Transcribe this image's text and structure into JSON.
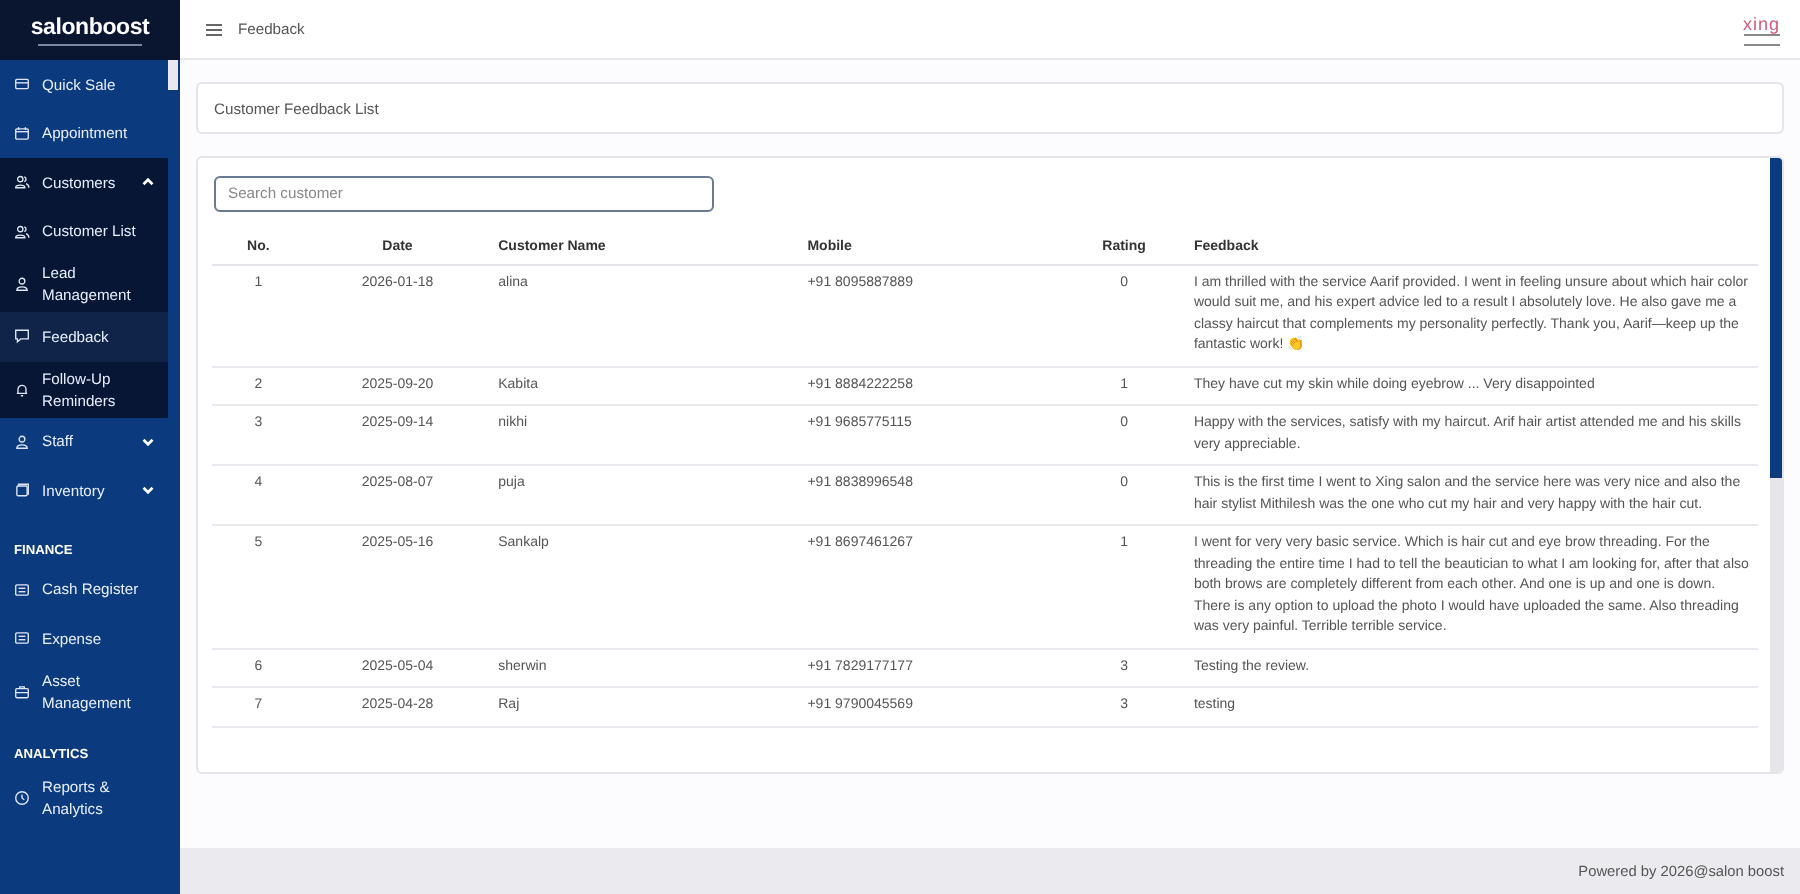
{
  "sidebar": {
    "logo": "salonboost",
    "items": [
      {
        "kind": "item",
        "label": "Quick Sale",
        "selected": false
      },
      {
        "kind": "item",
        "label": "Appointment",
        "selected": false
      },
      {
        "kind": "group",
        "label": "Customers",
        "expanded": true,
        "children": [
          {
            "kind": "item",
            "label": "Customer List",
            "selected": false
          },
          {
            "kind": "item",
            "label": "Lead Management",
            "selected": false
          },
          {
            "kind": "item",
            "label": "Feedback",
            "selected": true
          },
          {
            "kind": "item",
            "label": "Follow-Up Reminders",
            "selected": false
          }
        ]
      },
      {
        "kind": "group",
        "label": "Staff",
        "expanded": false
      },
      {
        "kind": "group",
        "label": "Inventory",
        "expanded": false
      },
      {
        "kind": "section",
        "label": "FINANCE"
      },
      {
        "kind": "item",
        "label": "Cash Register",
        "selected": false
      },
      {
        "kind": "item",
        "label": "Expense",
        "selected": false
      },
      {
        "kind": "item",
        "label": "Asset Management",
        "selected": false
      },
      {
        "kind": "section",
        "label": "ANALYTICS"
      },
      {
        "kind": "item",
        "label": "Reports & Analytics",
        "selected": false
      }
    ]
  },
  "header": {
    "title": "Feedback",
    "brand": "xing"
  },
  "page_title": "Customer Feedback List",
  "search": {
    "placeholder": "Search customer"
  },
  "table": {
    "columns": [
      "No.",
      "Date",
      "Customer Name",
      "Mobile",
      "Rating",
      "Feedback"
    ],
    "rows": [
      {
        "no": "1",
        "date": "2026-01-18",
        "name": "alina",
        "mobile": "+91 8095887889",
        "rating": "0",
        "feedback": "I am thrilled with the service Aarif provided. I went in feeling unsure about which hair color would suit me, and his expert advice led to a result I absolutely love. He also gave me a classy haircut that complements my personality perfectly. Thank you, Aarif—keep up the fantastic work! 👏"
      },
      {
        "no": "2",
        "date": "2025-09-20",
        "name": "Kabita",
        "mobile": "+91 8884222258",
        "rating": "1",
        "feedback": "They have cut my skin while doing eyebrow ... Very disappointed"
      },
      {
        "no": "3",
        "date": "2025-09-14",
        "name": "nikhi",
        "mobile": "+91 9685775115",
        "rating": "0",
        "feedback": "Happy with the services, satisfy with my haircut. Arif hair artist attended me and his skills very appreciable."
      },
      {
        "no": "4",
        "date": "2025-08-07",
        "name": "puja",
        "mobile": "+91 8838996548",
        "rating": "0",
        "feedback": "This is the first time I went to Xing salon and the service here was very nice and also the hair stylist Mithilesh was the one who cut my hair and very happy with the hair cut."
      },
      {
        "no": "5",
        "date": "2025-05-16",
        "name": "Sankalp",
        "mobile": "+91 8697461267",
        "rating": "1",
        "feedback": "I went for very very basic service. Which is hair cut and eye brow threading. For the threading the entire time I had to tell the beautician to what I am looking for, after that also both brows are completely different from each other. And one is up and one is down. There is any option to upload the photo I would have uploaded the same. Also threading was very painful. Terrible terrible service."
      },
      {
        "no": "6",
        "date": "2025-05-04",
        "name": "sherwin",
        "mobile": "+91 7829177177",
        "rating": "3",
        "feedback": "Testing the review."
      },
      {
        "no": "7",
        "date": "2025-04-28",
        "name": "Raj",
        "mobile": "+91 9790045569",
        "rating": "3",
        "feedback": "testing"
      }
    ]
  },
  "footer": "Powered by 2026@salon boost"
}
